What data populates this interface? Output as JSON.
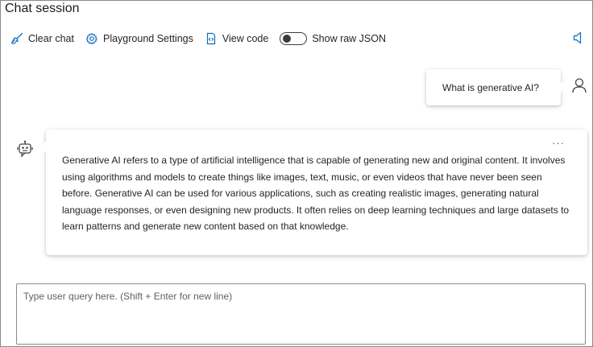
{
  "header": {
    "title": "Chat session"
  },
  "toolbar": {
    "clear_label": "Clear chat",
    "settings_label": "Playground Settings",
    "code_label": "View code",
    "json_label": "Show raw JSON",
    "json_toggle_on": false
  },
  "conversation": {
    "user_message": "What is generative AI?",
    "assistant_message": "Generative AI refers to a type of artificial intelligence that is capable of generating new and original content. It involves using algorithms and models to create things like images, text, music, or even videos that have never been seen before. Generative AI can be used for various applications, such as creating realistic images, generating natural language responses, or even designing new products. It often relies on deep learning techniques and large datasets to learn patterns and generate new content based on that knowledge.",
    "more_label": "···"
  },
  "composer": {
    "placeholder": "Type user query here. (Shift + Enter for new line)"
  },
  "icons": {
    "clear": "broom-icon",
    "settings": "gear-icon",
    "code": "code-file-icon",
    "speaker": "speaker-icon",
    "user": "person-icon",
    "bot": "bot-icon"
  },
  "colors": {
    "accent": "#0f6cbd",
    "text": "#242424",
    "border": "#8a8a8a"
  }
}
